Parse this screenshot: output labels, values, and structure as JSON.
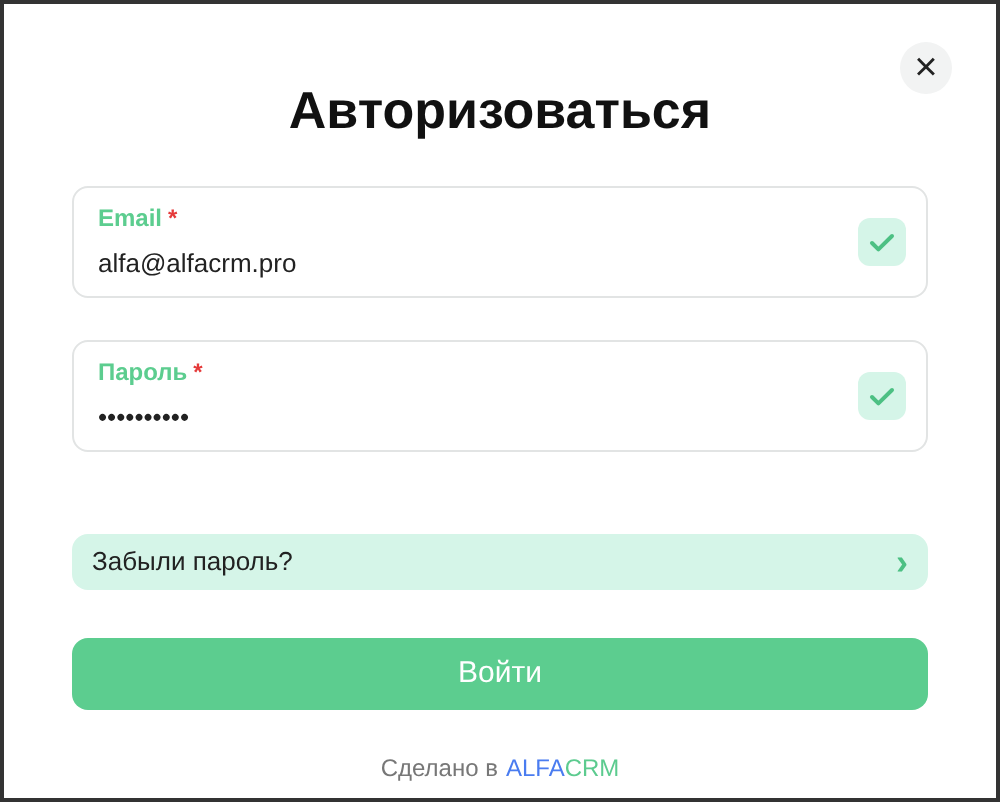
{
  "dialog": {
    "title": "Авторизоваться",
    "close": "×"
  },
  "fields": [
    {
      "label": "Email",
      "required_mark": "*",
      "value": "alfa@alfacrm.pro",
      "valid": true
    },
    {
      "label": "Пароль",
      "required_mark": "*",
      "value": "••••••••••",
      "valid": true
    }
  ],
  "forgot_link": {
    "label": "Забыли пароль?",
    "chevron": "›"
  },
  "submit": {
    "label": "Войти"
  },
  "footer": {
    "text": "Сделано в",
    "brand": [
      {
        "text": "ALFA",
        "color": "#4a7cf0"
      },
      {
        "text": "CRM",
        "color": "#5ccb8f"
      }
    ]
  }
}
